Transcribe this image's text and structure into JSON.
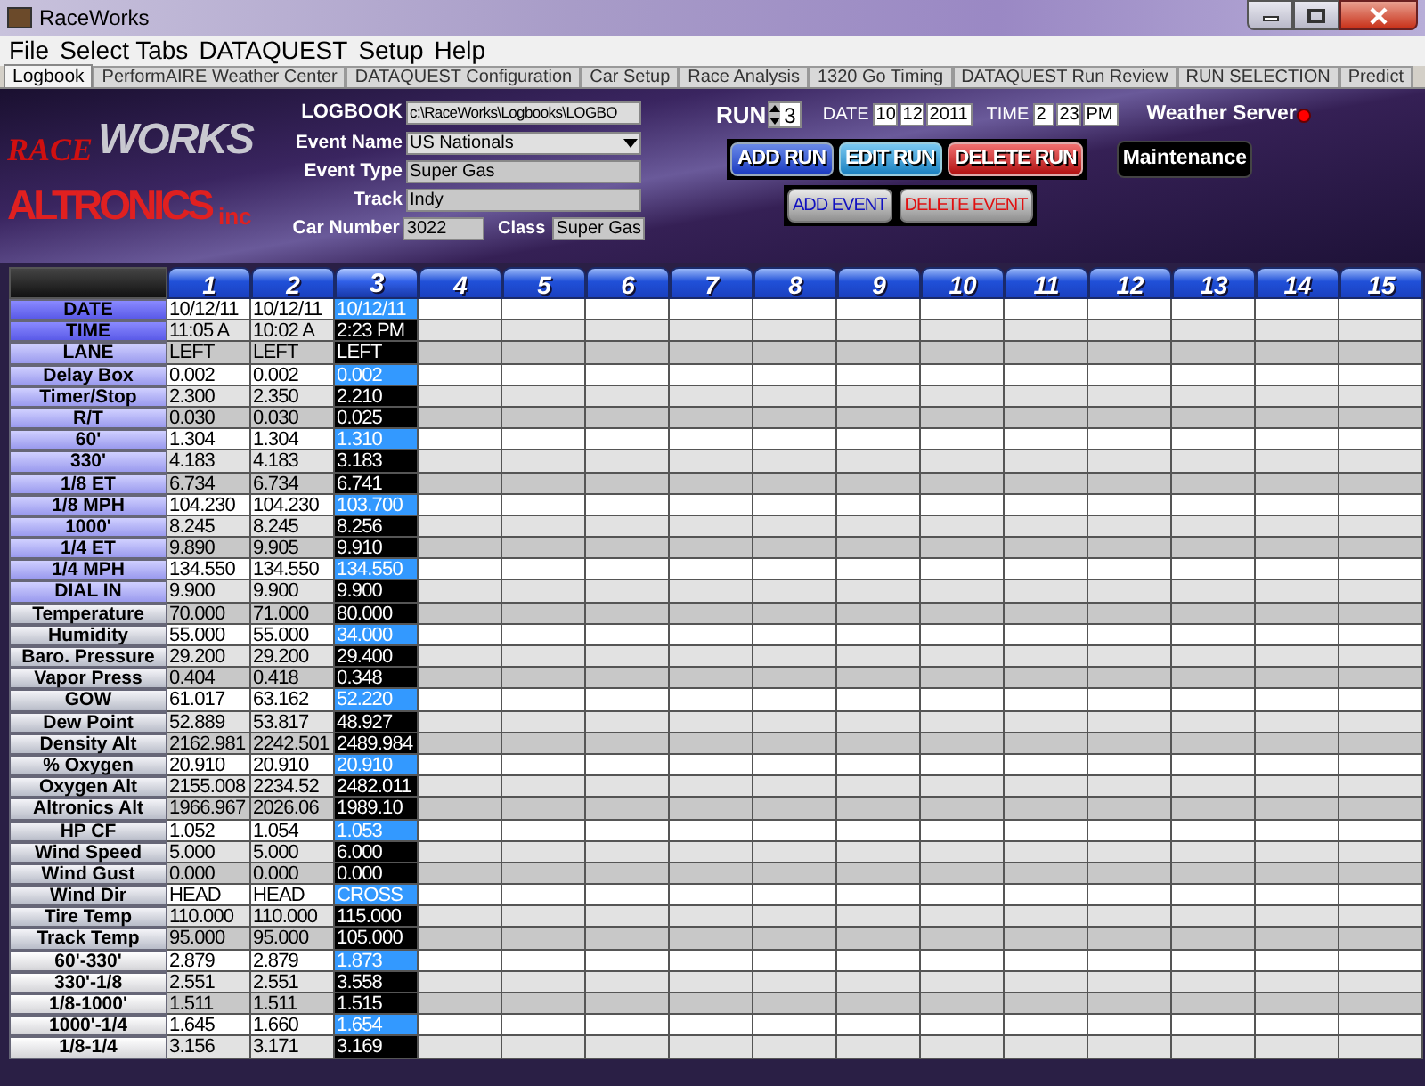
{
  "window": {
    "title": "RaceWorks"
  },
  "menu": [
    "File",
    "Select Tabs",
    "DATAQUEST",
    "Setup",
    "Help"
  ],
  "tabs": [
    {
      "label": "Logbook",
      "selected": true
    },
    {
      "label": "PerformAIRE Weather Center",
      "selected": false
    },
    {
      "label": "DATAQUEST Configuration",
      "selected": false
    },
    {
      "label": "Car Setup",
      "selected": false
    },
    {
      "label": "Race Analysis",
      "selected": false
    },
    {
      "label": "1320 Go Timing",
      "selected": false
    },
    {
      "label": "DATAQUEST Run Review",
      "selected": false
    },
    {
      "label": "RUN SELECTION",
      "selected": false
    },
    {
      "label": "Predict",
      "selected": false
    }
  ],
  "logo": {
    "race": "RACE",
    "works": "WORKS",
    "company": "ALTRONICS",
    "suffix": "inc"
  },
  "event_form": {
    "logbook": {
      "label": "LOGBOOK",
      "value": "c:\\RaceWorks\\Logbooks\\LOGBO"
    },
    "event_name": {
      "label": "Event Name",
      "value": "US Nationals"
    },
    "event_type": {
      "label": "Event Type",
      "value": "Super Gas"
    },
    "track": {
      "label": "Track",
      "value": "Indy"
    },
    "car_number": {
      "label": "Car Number",
      "value": "3022"
    },
    "class": {
      "label": "Class",
      "value": "Super Gas"
    }
  },
  "run": {
    "label": "RUN",
    "value": "3"
  },
  "date": {
    "label": "DATE",
    "month": "10",
    "day": "12",
    "year": "2011"
  },
  "time": {
    "label": "TIME",
    "hour": "2",
    "minute": "23",
    "ampm": "PM"
  },
  "weather_server": {
    "label": "Weather Server",
    "color": "#ff0000"
  },
  "buttons": [
    {
      "label": "ADD RUN",
      "kind": "add"
    },
    {
      "label": "EDIT RUN",
      "kind": "edit"
    },
    {
      "label": "DELETE RUN",
      "kind": "delete"
    }
  ],
  "maintenance": "Maintenance",
  "event_buttons": [
    {
      "label": "ADD EVENT",
      "kind": "add"
    },
    {
      "label": "DELETE EVENT",
      "kind": "delete"
    }
  ],
  "columns": [
    {
      "label": "1",
      "selected": false
    },
    {
      "label": "2",
      "selected": false
    },
    {
      "label": "3",
      "selected": true
    },
    {
      "label": "4",
      "selected": false
    },
    {
      "label": "5",
      "selected": false
    },
    {
      "label": "6",
      "selected": false
    },
    {
      "label": "7",
      "selected": false
    },
    {
      "label": "8",
      "selected": false
    },
    {
      "label": "9",
      "selected": false
    },
    {
      "label": "10",
      "selected": false
    },
    {
      "label": "11",
      "selected": false
    },
    {
      "label": "12",
      "selected": false
    },
    {
      "label": "13",
      "selected": false
    },
    {
      "label": "14",
      "selected": false
    },
    {
      "label": "15",
      "selected": false
    }
  ],
  "rows": [
    {
      "label": "DATE",
      "kind": "key",
      "values": [
        "10/12/11",
        "10/12/11",
        "10/12/11"
      ]
    },
    {
      "label": "TIME",
      "kind": "key",
      "values": [
        "11:05 A",
        "10:02 A",
        "2:23 PM"
      ]
    },
    {
      "label": "LANE",
      "kind": "run",
      "values": [
        "LEFT",
        "LEFT",
        "LEFT"
      ]
    },
    {
      "label": "Delay Box",
      "kind": "run",
      "values": [
        "0.002",
        "0.002",
        "0.002"
      ]
    },
    {
      "label": "Timer/Stop",
      "kind": "run",
      "values": [
        "2.300",
        "2.350",
        "2.210"
      ]
    },
    {
      "label": "R/T",
      "kind": "run",
      "values": [
        "0.030",
        "0.030",
        "0.025"
      ]
    },
    {
      "label": "60'",
      "kind": "run",
      "values": [
        "1.304",
        "1.304",
        "1.310"
      ]
    },
    {
      "label": "330'",
      "kind": "run",
      "values": [
        "4.183",
        "4.183",
        "3.183"
      ]
    },
    {
      "label": "1/8 ET",
      "kind": "run",
      "values": [
        "6.734",
        "6.734",
        "6.741"
      ]
    },
    {
      "label": "1/8 MPH",
      "kind": "run",
      "values": [
        "104.230",
        "104.230",
        "103.700"
      ]
    },
    {
      "label": "1000'",
      "kind": "run",
      "values": [
        "8.245",
        "8.245",
        "8.256"
      ]
    },
    {
      "label": "1/4 ET",
      "kind": "run",
      "values": [
        "9.890",
        "9.905",
        "9.910"
      ]
    },
    {
      "label": "1/4 MPH",
      "kind": "run",
      "values": [
        "134.550",
        "134.550",
        "134.550"
      ]
    },
    {
      "label": "DIAL IN",
      "kind": "run",
      "values": [
        "9.900",
        "9.900",
        "9.900"
      ]
    },
    {
      "label": "Temperature",
      "kind": "weather",
      "values": [
        "70.000",
        "71.000",
        "80.000"
      ]
    },
    {
      "label": "Humidity",
      "kind": "weather",
      "values": [
        "55.000",
        "55.000",
        "34.000"
      ]
    },
    {
      "label": "Baro. Pressure",
      "kind": "weather",
      "values": [
        "29.200",
        "29.200",
        "29.400"
      ]
    },
    {
      "label": "Vapor Press",
      "kind": "weather",
      "values": [
        "0.404",
        "0.418",
        "0.348"
      ]
    },
    {
      "label": "GOW",
      "kind": "weather",
      "values": [
        "61.017",
        "63.162",
        "52.220"
      ]
    },
    {
      "label": "Dew Point",
      "kind": "weather",
      "values": [
        "52.889",
        "53.817",
        "48.927"
      ]
    },
    {
      "label": "Density Alt",
      "kind": "weather",
      "values": [
        "2162.981",
        "2242.501",
        "2489.984"
      ]
    },
    {
      "label": "% Oxygen",
      "kind": "weather",
      "values": [
        "20.910",
        "20.910",
        "20.910"
      ]
    },
    {
      "label": "Oxygen Alt",
      "kind": "weather",
      "values": [
        "2155.008",
        "2234.52",
        "2482.011"
      ]
    },
    {
      "label": "Altronics Alt",
      "kind": "weather",
      "values": [
        "1966.967",
        "2026.06",
        "1989.10"
      ]
    },
    {
      "label": "HP CF",
      "kind": "weather",
      "values": [
        "1.052",
        "1.054",
        "1.053"
      ]
    },
    {
      "label": "Wind Speed",
      "kind": "weather",
      "values": [
        "5.000",
        "5.000",
        "6.000"
      ]
    },
    {
      "label": "Wind Gust",
      "kind": "weather",
      "values": [
        "0.000",
        "0.000",
        "0.000"
      ]
    },
    {
      "label": "Wind Dir",
      "kind": "weather",
      "values": [
        "HEAD",
        "HEAD",
        "CROSS"
      ]
    },
    {
      "label": "Tire Temp",
      "kind": "weather",
      "values": [
        "110.000",
        "110.000",
        "115.000"
      ]
    },
    {
      "label": "Track Temp",
      "kind": "weather",
      "values": [
        "95.000",
        "95.000",
        "105.000"
      ]
    },
    {
      "label": "60'-330'",
      "kind": "split",
      "values": [
        "2.879",
        "2.879",
        "1.873"
      ]
    },
    {
      "label": "330'-1/8",
      "kind": "split",
      "values": [
        "2.551",
        "2.551",
        "3.558"
      ]
    },
    {
      "label": "1/8-1000'",
      "kind": "split",
      "values": [
        "1.511",
        "1.511",
        "1.515"
      ]
    },
    {
      "label": "1000'-1/4",
      "kind": "split",
      "values": [
        "1.645",
        "1.660",
        "1.654"
      ]
    },
    {
      "label": "1/8-1/4",
      "kind": "split",
      "values": [
        "3.156",
        "3.171",
        "3.169"
      ]
    }
  ]
}
